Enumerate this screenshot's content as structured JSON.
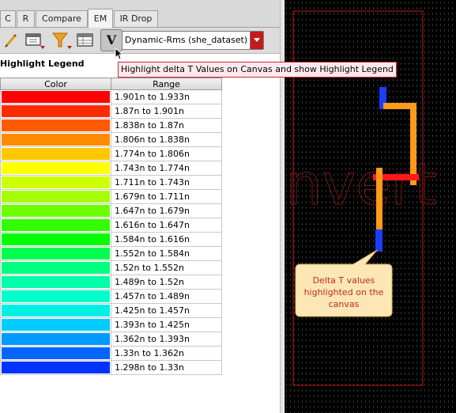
{
  "tabs": [
    {
      "label": "C",
      "active": false
    },
    {
      "label": "R",
      "active": false
    },
    {
      "label": "Compare",
      "active": false
    },
    {
      "label": "EM",
      "active": true
    },
    {
      "label": "IR Drop",
      "active": false
    }
  ],
  "toolbar": {
    "dropdown_value": "Dynamic-Rms (she_dataset)",
    "v_button_label": "V"
  },
  "tooltip": "Highlight delta T Values on Canvas and show Highlight Legend",
  "legend": {
    "title": "Highlight Legend",
    "headers": {
      "color": "Color",
      "range": "Range"
    },
    "rows": [
      {
        "color": "#ff0000",
        "range": "1.901n to 1.933n"
      },
      {
        "color": "#ff2a00",
        "range": "1.87n to 1.901n"
      },
      {
        "color": "#ff5a00",
        "range": "1.838n to 1.87n"
      },
      {
        "color": "#ff8c00",
        "range": "1.806n to 1.838n"
      },
      {
        "color": "#ffc800",
        "range": "1.774n to 1.806n"
      },
      {
        "color": "#ffff00",
        "range": "1.743n to 1.774n"
      },
      {
        "color": "#ccff00",
        "range": "1.711n to 1.743n"
      },
      {
        "color": "#a6ff00",
        "range": "1.679n to 1.711n"
      },
      {
        "color": "#6cff00",
        "range": "1.647n to 1.679n"
      },
      {
        "color": "#33ff00",
        "range": "1.616n to 1.647n"
      },
      {
        "color": "#00ff00",
        "range": "1.584n to 1.616n"
      },
      {
        "color": "#00ff4c",
        "range": "1.552n to 1.584n"
      },
      {
        "color": "#00ff80",
        "range": "1.52n to 1.552n"
      },
      {
        "color": "#00ffaa",
        "range": "1.489n to 1.52n"
      },
      {
        "color": "#00ffcc",
        "range": "1.457n to 1.489n"
      },
      {
        "color": "#00f0e6",
        "range": "1.425n to 1.457n"
      },
      {
        "color": "#00ccff",
        "range": "1.393n to 1.425n"
      },
      {
        "color": "#0099ff",
        "range": "1.362n to 1.393n"
      },
      {
        "color": "#0066ff",
        "range": "1.33n to 1.362n"
      },
      {
        "color": "#0033ff",
        "range": "1.298n to 1.33n"
      }
    ]
  },
  "canvas": {
    "callout_text": "Delta T values highlighted on the canvas",
    "watermark_text": "nvert"
  },
  "icons": [
    "pencil-icon",
    "layout-icon",
    "filter-icon",
    "table-icon",
    "v-icon"
  ]
}
